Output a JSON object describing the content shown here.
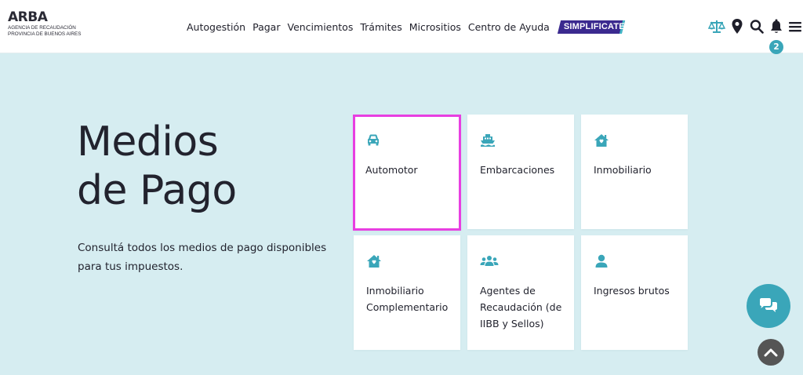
{
  "brand": {
    "title": "ARBA",
    "subtitle_line1": "AGENCIA DE RECAUDACIÓN",
    "subtitle_line2": "PROVINCIA DE BUENOS AIRES"
  },
  "nav": {
    "items": [
      "Autogestión",
      "Pagar",
      "Vencimientos",
      "Trámites",
      "Micrositios",
      "Centro de Ayuda"
    ],
    "highlight": "SIMPLIFICATE"
  },
  "header_icons": [
    "scale-icon",
    "map-pin-icon",
    "search-icon",
    "bell-icon",
    "menu-icon"
  ],
  "notifications": {
    "count": "2"
  },
  "hero": {
    "title_line1": "Medios",
    "title_line2": "de Pago",
    "description": "Consultá todos los medios de pago disponibles para tus impuestos."
  },
  "cards": [
    {
      "label": "Automotor",
      "icon": "car-icon",
      "selected": true
    },
    {
      "label": "Embarcaciones",
      "icon": "boat-icon",
      "selected": false
    },
    {
      "label": "Inmobiliario",
      "icon": "house-icon",
      "selected": false
    },
    {
      "label": "Inmobiliario Complementario",
      "icon": "house-icon",
      "selected": false
    },
    {
      "label": "Agentes de Recaudación (de IIBB y Sellos)",
      "icon": "group-icon",
      "selected": false
    },
    {
      "label": "Ingresos brutos",
      "icon": "person-icon",
      "selected": false
    }
  ],
  "colors": {
    "accent": "#3aa6b9",
    "brand_purple": "#3b2a8f",
    "selection": "#e83fe1",
    "background": "#d6edf1"
  }
}
